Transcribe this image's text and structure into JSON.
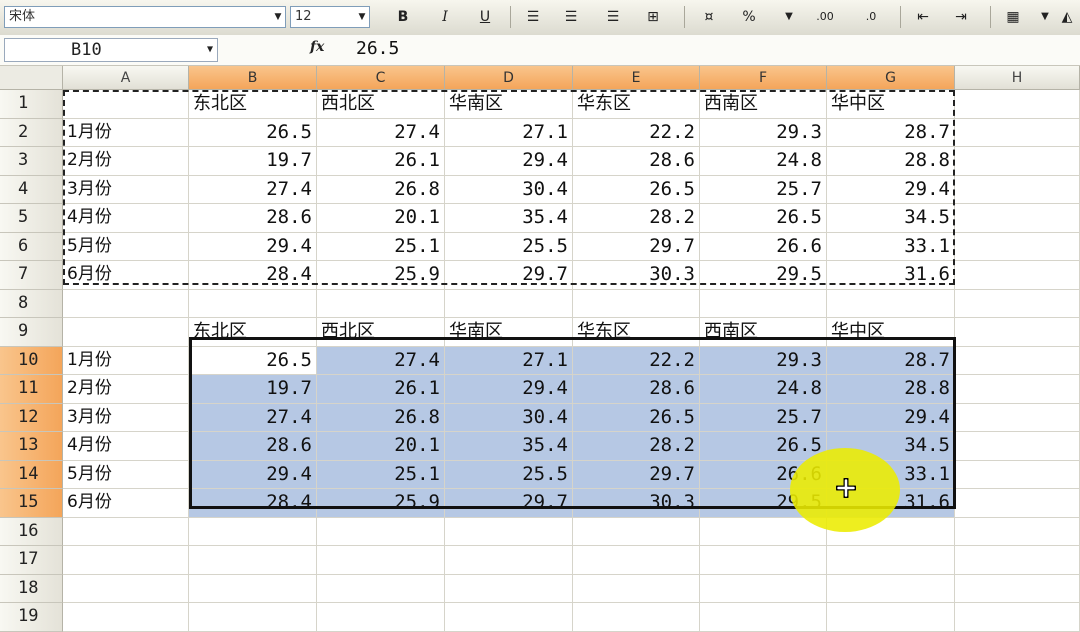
{
  "toolbar": {
    "font_name": "宋体",
    "font_size": "12",
    "bold": "B",
    "italic": "I",
    "underline": "U",
    "percent": "%",
    "increase_decimal": ".00",
    "decrease_decimal": ".0"
  },
  "formula_bar": {
    "name_box": "B10",
    "fx": "fx",
    "value": "26.5"
  },
  "columns": [
    "A",
    "B",
    "C",
    "D",
    "E",
    "F",
    "G",
    "H"
  ],
  "rows": [
    "1",
    "2",
    "3",
    "4",
    "5",
    "6",
    "7",
    "8",
    "9",
    "10",
    "11",
    "12",
    "13",
    "14",
    "15",
    "16",
    "17",
    "18",
    "19"
  ],
  "table1": {
    "headers": [
      "东北区",
      "西北区",
      "华南区",
      "华东区",
      "西南区",
      "华中区"
    ],
    "months": [
      "1月份",
      "2月份",
      "3月份",
      "4月份",
      "5月份",
      "6月份"
    ],
    "values": [
      [
        "26.5",
        "27.4",
        "27.1",
        "22.2",
        "29.3",
        "28.7"
      ],
      [
        "19.7",
        "26.1",
        "29.4",
        "28.6",
        "24.8",
        "28.8"
      ],
      [
        "27.4",
        "26.8",
        "30.4",
        "26.5",
        "25.7",
        "29.4"
      ],
      [
        "28.6",
        "20.1",
        "35.4",
        "28.2",
        "26.5",
        "34.5"
      ],
      [
        "29.4",
        "25.1",
        "25.5",
        "29.7",
        "26.6",
        "33.1"
      ],
      [
        "28.4",
        "25.9",
        "29.7",
        "30.3",
        "29.5",
        "31.6"
      ]
    ]
  },
  "table2": {
    "headers": [
      "东北区",
      "西北区",
      "华南区",
      "华东区",
      "西南区",
      "华中区"
    ],
    "months": [
      "1月份",
      "2月份",
      "3月份",
      "4月份",
      "5月份",
      "6月份"
    ],
    "values": [
      [
        "26.5",
        "27.4",
        "27.1",
        "22.2",
        "29.3",
        "28.7"
      ],
      [
        "19.7",
        "26.1",
        "29.4",
        "28.6",
        "24.8",
        "28.8"
      ],
      [
        "27.4",
        "26.8",
        "30.4",
        "26.5",
        "25.7",
        "29.4"
      ],
      [
        "28.6",
        "20.1",
        "35.4",
        "28.2",
        "26.5",
        "34.5"
      ],
      [
        "29.4",
        "25.1",
        "25.5",
        "29.7",
        "26.6",
        "33.1"
      ],
      [
        "28.4",
        "25.9",
        "29.7",
        "30.3",
        "29.5",
        "31.6"
      ]
    ]
  },
  "colors": {
    "selection_fill": "#b6c8e4",
    "header_highlight": "#f4a55a",
    "cursor_highlight": "#ecec00"
  },
  "icons": [
    "dropdown-arrow-icon",
    "fx-icon",
    "align-left-icon",
    "align-center-icon",
    "align-right-icon",
    "merge-center-icon",
    "currency-icon",
    "indent-icon",
    "outdent-icon",
    "borders-icon",
    "fill-color-icon",
    "move-cursor-icon"
  ]
}
